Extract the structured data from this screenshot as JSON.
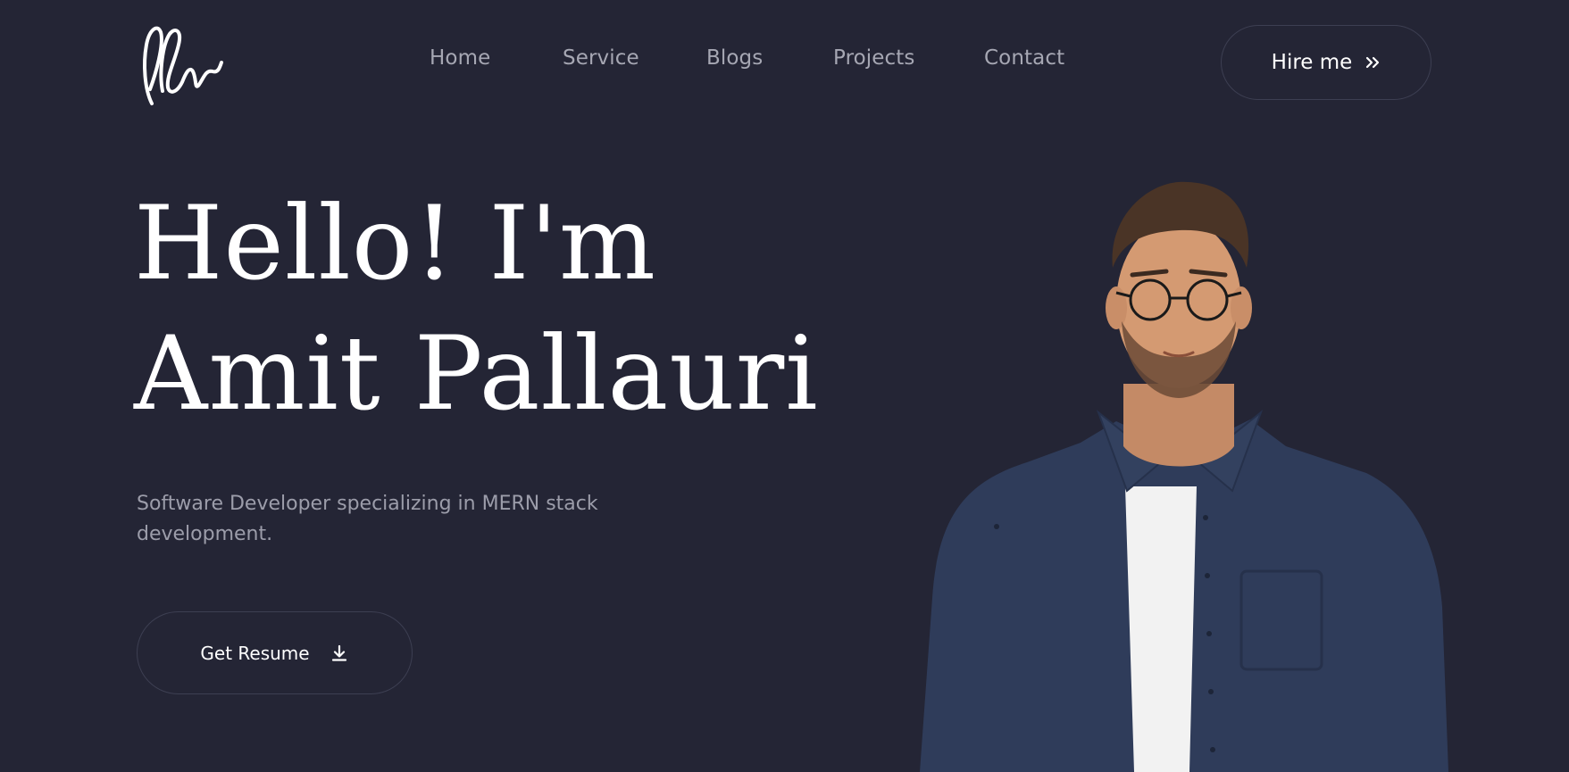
{
  "header": {
    "nav": [
      "Home",
      "Service",
      "Blogs",
      "Projects",
      "Contact"
    ],
    "hire_label": "Hire me"
  },
  "hero": {
    "title_line1": "Hello! I'm",
    "title_line2": "Amit Pallauri",
    "subtitle": "Software Developer specializing in MERN stack development.",
    "resume_label": "Get Resume"
  },
  "icons": {
    "logo": "signature-logo",
    "hire": "double-chevron-right-icon",
    "resume": "download-icon"
  },
  "colors": {
    "background": "#242535",
    "text": "#ffffff",
    "muted": "#a6a7b3",
    "border": "#3d3f52",
    "shirt": "#2f3c5a"
  }
}
